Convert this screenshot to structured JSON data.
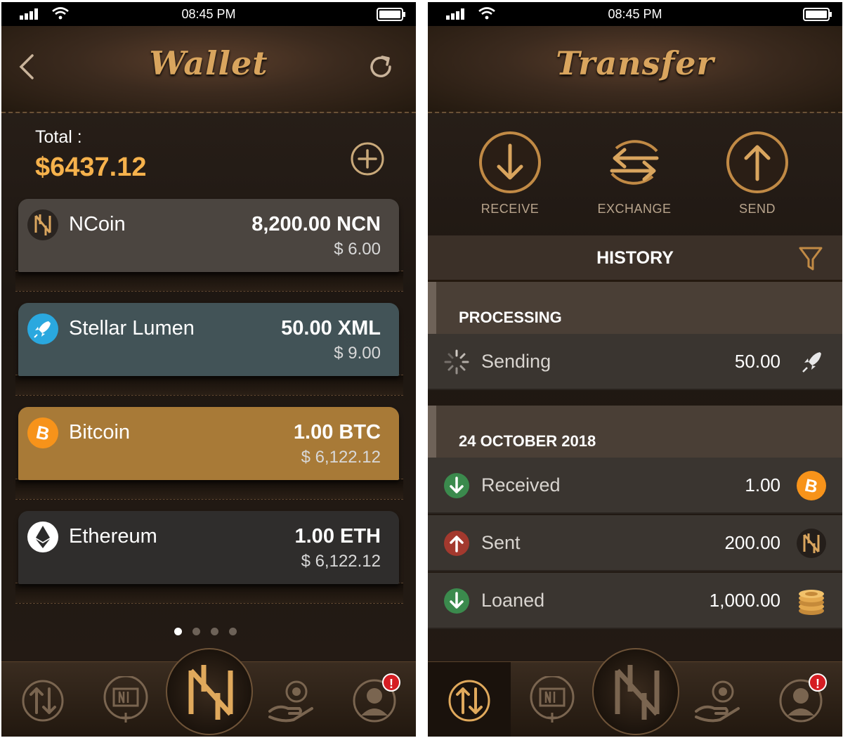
{
  "status_bar": {
    "time": "08:45 PM"
  },
  "wallet": {
    "title": "Wallet",
    "total_label": "Total :",
    "total_value": "$6437.12",
    "cards": [
      {
        "name": "NCoin",
        "amount": "8,200.00 NCN",
        "usd": "$ 6.00",
        "color": "#4b4540",
        "icon": "ncoin-icon"
      },
      {
        "name": "Stellar Lumen",
        "amount": "50.00 XML",
        "usd": "$ 9.00",
        "color": "#425357",
        "icon": "stellar-rocket-icon"
      },
      {
        "name": "Bitcoin",
        "amount": "1.00 BTC",
        "usd": "$ 6,122.12",
        "color": "#a87a37",
        "icon": "bitcoin-icon"
      },
      {
        "name": "Ethereum",
        "amount": "1.00 ETH",
        "usd": "$ 6,122.12",
        "color": "#2f2d2c",
        "icon": "ethereum-icon"
      }
    ],
    "page_indicator": {
      "pages": 4,
      "active": 1
    }
  },
  "transfer": {
    "title": "Transfer",
    "actions": [
      {
        "label": "RECEIVE",
        "icon": "arrow-down-circle-icon"
      },
      {
        "label": "EXCHANGE",
        "icon": "exchange-arrows-icon"
      },
      {
        "label": "SEND",
        "icon": "arrow-up-circle-icon"
      }
    ],
    "history_title": "HISTORY",
    "processing_label": "PROCESSING",
    "processing_rows": [
      {
        "label": "Sending",
        "amount": "50.00",
        "status_icon": "spinner-icon",
        "coin_icon": "stellar-rocket-icon"
      }
    ],
    "date_label": "24 OCTOBER 2018",
    "rows": [
      {
        "label": "Received",
        "amount": "1.00",
        "status_icon": "arrow-down-green-icon",
        "coin_icon": "bitcoin-icon"
      },
      {
        "label": "Sent",
        "amount": "200.00",
        "status_icon": "arrow-up-red-icon",
        "coin_icon": "ncoin-icon"
      },
      {
        "label": "Loaned",
        "amount": "1,000.00",
        "status_icon": "arrow-down-green-icon",
        "coin_icon": "coin-stack-icon"
      }
    ]
  },
  "tabbar": {
    "items": [
      "transfer-tab",
      "add-wallet-tab",
      "ncoin-home-tab",
      "loan-tab",
      "profile-tab"
    ],
    "notification_badge": "!"
  },
  "colors": {
    "accent_gold": "#d9a55e",
    "total_orange": "#f6b24c",
    "received_green": "#3b8a4d",
    "sent_red": "#a3392e",
    "notification_red": "#d51d23"
  }
}
